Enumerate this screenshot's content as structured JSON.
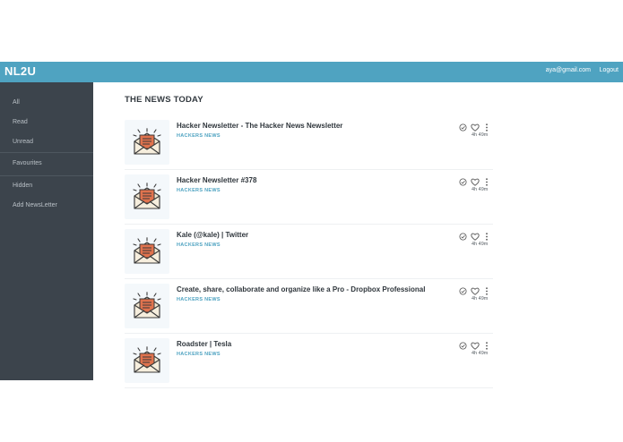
{
  "header": {
    "brand": "NL2U",
    "user_email": "aya@gmail.com",
    "logout_label": "Logout"
  },
  "sidebar": {
    "items": [
      {
        "label": "All"
      },
      {
        "label": "Read"
      },
      {
        "label": "Unread"
      },
      {
        "label": "Favourites"
      },
      {
        "label": "Hidden"
      },
      {
        "label": "Add NewsLetter"
      }
    ]
  },
  "main": {
    "title": "THE NEWS TODAY",
    "newsletters": [
      {
        "title": "Hacker Newsletter - The Hacker News Newsletter",
        "source": "HACKERS NEWS",
        "time": "4h 49m"
      },
      {
        "title": "Hacker Newsletter #378",
        "source": "HACKERS NEWS",
        "time": "4h 49m"
      },
      {
        "title": "Kale (@kale) | Twitter",
        "source": "HACKERS NEWS",
        "time": "4h 49m"
      },
      {
        "title": "Create, share, collaborate and organize like a Pro - Dropbox Professional",
        "source": "HACKERS NEWS",
        "time": "4h 49m"
      },
      {
        "title": "Roadster | Tesla",
        "source": "HACKERS NEWS",
        "time": "4h 49m"
      }
    ]
  },
  "icons": {
    "thumbnail": "envelope-newsletter-icon",
    "mark_read": "check-circle-icon",
    "favourite": "heart-icon",
    "more": "vertical-dots-icon"
  },
  "colors": {
    "header": "#4fa3c1",
    "sidebar": "#3c444c",
    "source": "#4fa3c1"
  }
}
